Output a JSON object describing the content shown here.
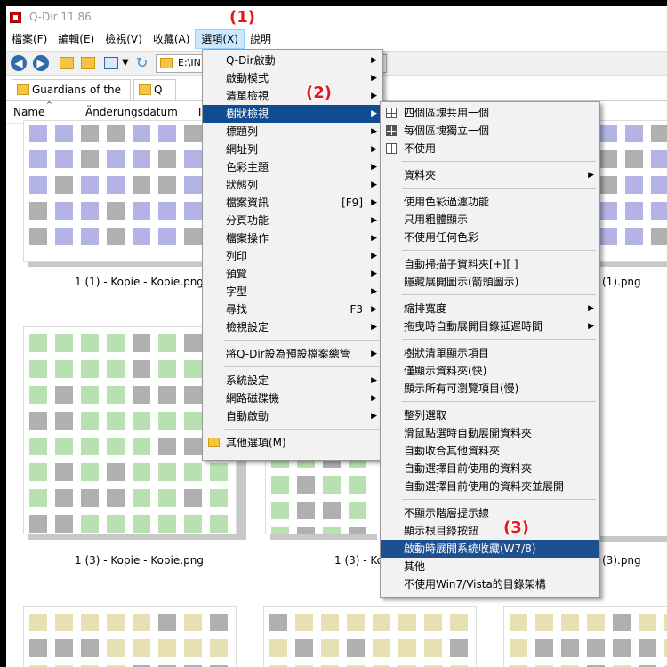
{
  "window": {
    "title": "Q-Dir 11.86"
  },
  "menubar": [
    "檔案(F)",
    "編輯(E)",
    "檢視(V)",
    "收藏(A)",
    "選項(X)",
    "說明"
  ],
  "toolbar": {
    "address": "E:\\INI"
  },
  "tabs": [
    "Guardians of the ...",
    "Q"
  ],
  "columns": {
    "name": "Name",
    "date": "Änderungsdatum",
    "type": "T"
  },
  "captions": {
    "row1_left": "1 (1) - Kopie - Kopie.png",
    "row1_right": "(1).png",
    "row2_left": "1 (3) - Kopie - Kopie.png",
    "row2_mid": "1 (3) - Ko",
    "row2_right": "(3).png"
  },
  "options_menu": {
    "items": [
      {
        "label": "Q-Dir啟動",
        "arrow": "▶"
      },
      {
        "label": "啟動模式",
        "arrow": "▶"
      },
      {
        "label": "清單檢視",
        "arrow": "▶"
      },
      {
        "label": "樹狀檢視",
        "arrow": "▶"
      },
      {
        "label": "標題列",
        "arrow": "▶"
      },
      {
        "label": "網址列",
        "arrow": "▶"
      },
      {
        "label": "色彩主題",
        "arrow": "▶"
      },
      {
        "label": "狀態列",
        "arrow": "▶"
      },
      {
        "label": "檔案資訊",
        "shortcut": "[F9]",
        "arrow": "▶"
      },
      {
        "label": "分頁功能",
        "arrow": "▶"
      },
      {
        "label": "檔案操作",
        "arrow": "▶"
      },
      {
        "label": "列印",
        "arrow": "▶"
      },
      {
        "label": "預覽",
        "arrow": "▶"
      },
      {
        "label": "字型",
        "arrow": "▶"
      },
      {
        "label": "尋找",
        "shortcut": "F3",
        "arrow": "▶"
      },
      {
        "label": "檢視設定",
        "arrow": "▶"
      },
      {
        "label": "將Q-Dir設為預設檔案總管",
        "arrow": "▶"
      },
      {
        "label": "系統設定",
        "arrow": "▶"
      },
      {
        "label": "網路磁碟機",
        "arrow": "▶"
      },
      {
        "label": "自動啟動",
        "arrow": "▶"
      },
      {
        "label": "其他選項(M)"
      }
    ]
  },
  "tree_menu": {
    "items": [
      {
        "label": "四個區塊共用一個"
      },
      {
        "label": "每個區塊獨立一個"
      },
      {
        "label": "不使用"
      },
      {
        "label": "資料夾",
        "arrow": "▶"
      },
      {
        "label": "使用色彩過濾功能"
      },
      {
        "label": "只用粗體顯示"
      },
      {
        "label": "不使用任何色彩"
      },
      {
        "label": "自動掃描子資料夾[+][ ]"
      },
      {
        "label": "隱藏展開圖示(箭頭圖示)"
      },
      {
        "label": "縮排寬度",
        "arrow": "▶"
      },
      {
        "label": "拖曳時自動展開目錄延遲時間",
        "arrow": "▶"
      },
      {
        "label": "樹狀清單顯示項目"
      },
      {
        "label": "僅顯示資料夾(快)"
      },
      {
        "label": "顯示所有可瀏覽項目(慢)"
      },
      {
        "label": "整列選取"
      },
      {
        "label": "滑鼠點選時自動展開資料夾"
      },
      {
        "label": "自動收合其他資料夾"
      },
      {
        "label": "自動選擇目前使用的資料夾"
      },
      {
        "label": "自動選擇目前使用的資料夾並展開"
      },
      {
        "label": "不顯示階層提示線"
      },
      {
        "label": "顯示根目錄按鈕"
      },
      {
        "label": "啟動時展開系統收藏(W7/8)"
      },
      {
        "label": "其他"
      },
      {
        "label": "不使用Win7/Vista的目錄架構"
      }
    ]
  },
  "annotations": [
    "(1)",
    "(2)",
    "(3)"
  ],
  "colors": {
    "highlight": "#0f4c91",
    "annotation": "#e01818",
    "thumb_purple": "#b3b3e6",
    "thumb_green": "#b8e0b0",
    "thumb_yellow": "#e6e0b3",
    "cell_gray": "#b0b0b0"
  }
}
